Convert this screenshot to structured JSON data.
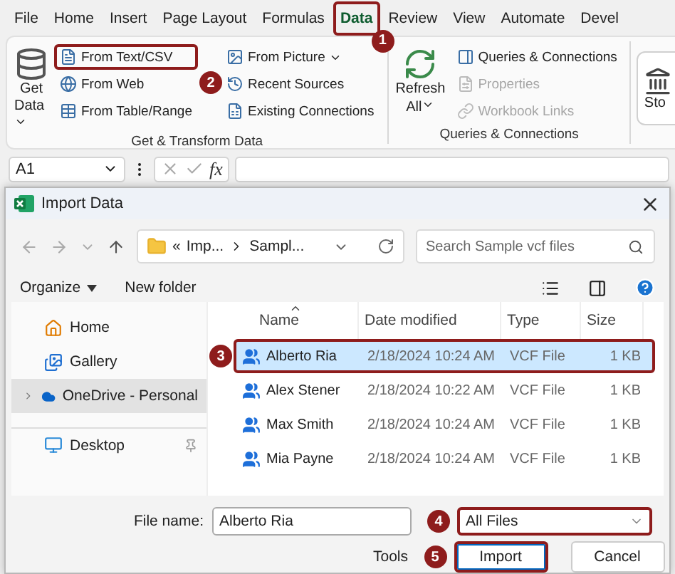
{
  "ribbon_tabs": [
    {
      "label": "File",
      "selected": false
    },
    {
      "label": "Home",
      "selected": false
    },
    {
      "label": "Insert",
      "selected": false
    },
    {
      "label": "Page Layout",
      "selected": false
    },
    {
      "label": "Formulas",
      "selected": false
    },
    {
      "label": "Data",
      "selected": true,
      "step": "1"
    },
    {
      "label": "Review",
      "selected": false
    },
    {
      "label": "View",
      "selected": false
    },
    {
      "label": "Automate",
      "selected": false
    },
    {
      "label": "Devel",
      "selected": false
    }
  ],
  "ribbon_groups": [
    {
      "label": "Get & Transform Data",
      "large": {
        "label_lines": [
          "Get",
          "Data"
        ],
        "dropdown": true
      },
      "columns": [
        [
          {
            "label": "From Text/CSV",
            "step": "2",
            "disabled": false
          },
          {
            "label": "From Web",
            "disabled": false
          },
          {
            "label": "From Table/Range",
            "disabled": false
          }
        ],
        [
          {
            "label": "From Picture",
            "dropdown": true,
            "disabled": false
          },
          {
            "label": "Recent Sources",
            "disabled": false
          },
          {
            "label": "Existing Connections",
            "disabled": false
          }
        ]
      ]
    },
    {
      "label": "Queries & Connections",
      "large": {
        "label_lines": [
          "Refresh",
          "All"
        ],
        "dropdown": true
      },
      "columns": [
        [
          {
            "label": "Queries & Connections",
            "disabled": false
          },
          {
            "label": "Properties",
            "disabled": true
          },
          {
            "label": "Workbook Links",
            "disabled": true
          }
        ]
      ]
    }
  ],
  "ribbon_partial": {
    "label": "Sto"
  },
  "formula_bar": {
    "name_box": "A1",
    "function_label": "fx"
  },
  "dialog": {
    "title": "Import Data",
    "address": {
      "overflow": "«",
      "crumbs": [
        "Imp...",
        "Sampl..."
      ]
    },
    "search": {
      "placeholder": "Search Sample vcf files"
    },
    "toolbar": {
      "organize": "Organize",
      "new_folder": "New folder"
    },
    "nav_items": [
      {
        "label": "Home",
        "selected": false
      },
      {
        "label": "Gallery",
        "selected": false
      },
      {
        "label": "OneDrive - Personal",
        "selected": true,
        "expandable": true
      },
      {
        "label": "Desktop",
        "selected": false,
        "pinned": true,
        "section_start": true
      }
    ],
    "columns": [
      {
        "label": "Name",
        "sorted": true
      },
      {
        "label": "Date modified",
        "sorted": false
      },
      {
        "label": "Type",
        "sorted": false
      },
      {
        "label": "Size",
        "sorted": false
      }
    ],
    "files": [
      {
        "name": "Alberto Ria",
        "date": "2/18/2024 10:24 AM",
        "type": "VCF File",
        "size": "1 KB",
        "selected": true,
        "step": "3"
      },
      {
        "name": "Alex Stener",
        "date": "2/18/2024 10:22 AM",
        "type": "VCF File",
        "size": "1 KB",
        "selected": false
      },
      {
        "name": "Max Smith",
        "date": "2/18/2024 10:24 AM",
        "type": "VCF File",
        "size": "1 KB",
        "selected": false
      },
      {
        "name": "Mia Payne",
        "date": "2/18/2024 10:24 AM",
        "type": "VCF File",
        "size": "1 KB",
        "selected": false
      }
    ],
    "file_name": {
      "label": "File name:",
      "value": "Alberto Ria"
    },
    "file_type": {
      "value": "All Files",
      "step": "4"
    },
    "tools": "Tools",
    "buttons": [
      {
        "label": "Import",
        "default": true,
        "step": "5"
      },
      {
        "label": "Cancel",
        "default": false
      }
    ]
  }
}
